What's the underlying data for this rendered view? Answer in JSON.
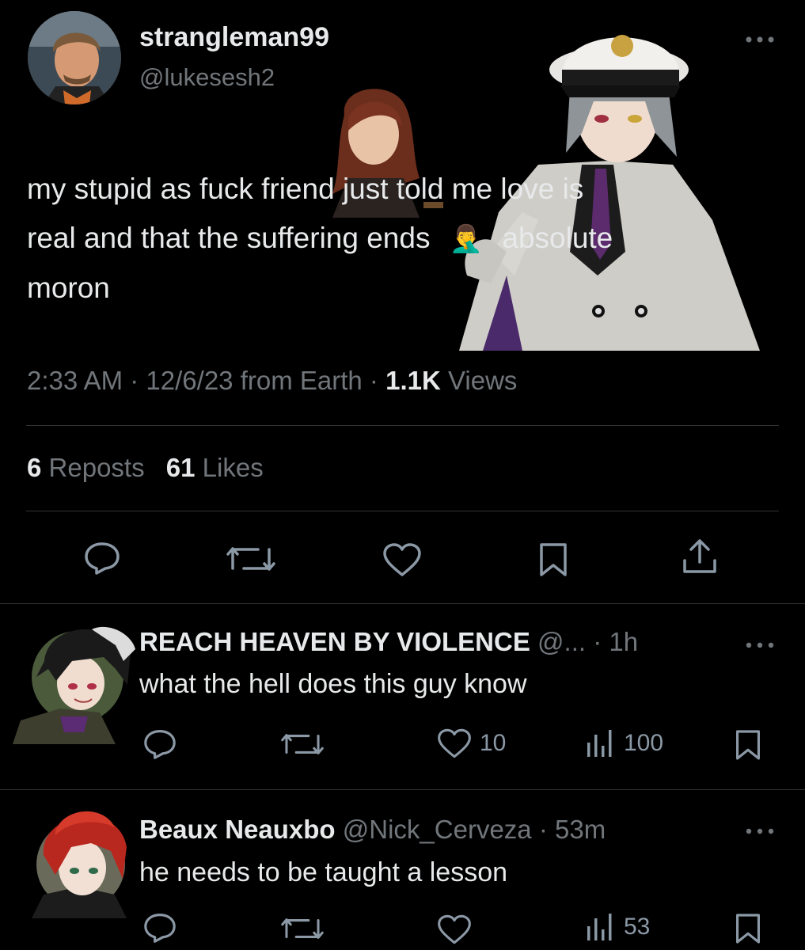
{
  "tweet": {
    "display_name": "strangleman99",
    "handle": "@lukesesh2",
    "text_line1": "my stupid as fuck friend just told me love is",
    "text_line2_a": "real and that the suffering ends",
    "emoji": "🤦‍♂️",
    "text_line2_b": "absolute",
    "text_line3": "moron",
    "time": "2:33 AM",
    "dot": "·",
    "date": "12/6/23",
    "from": "from Earth",
    "views_count": "1.1K",
    "views_label": "Views",
    "reposts_count": "6",
    "reposts_label": "Reposts",
    "likes_count": "61",
    "likes_label": "Likes"
  },
  "replies": [
    {
      "name": "REACH HEAVEN BY VIOLENCE",
      "handle": "@...",
      "time": "· 1h",
      "text": "what the hell does this guy know",
      "likes": "10",
      "views": "100"
    },
    {
      "name": "Beaux Neauxbo",
      "handle": "@Nick_Cerveza",
      "time": "· 53m",
      "text": "he needs to be taught a lesson",
      "likes": "",
      "views": "53"
    }
  ],
  "colors": {
    "background": "#000000",
    "text": "#e7e9ea",
    "muted": "#71767b",
    "divider": "#2f3336"
  }
}
